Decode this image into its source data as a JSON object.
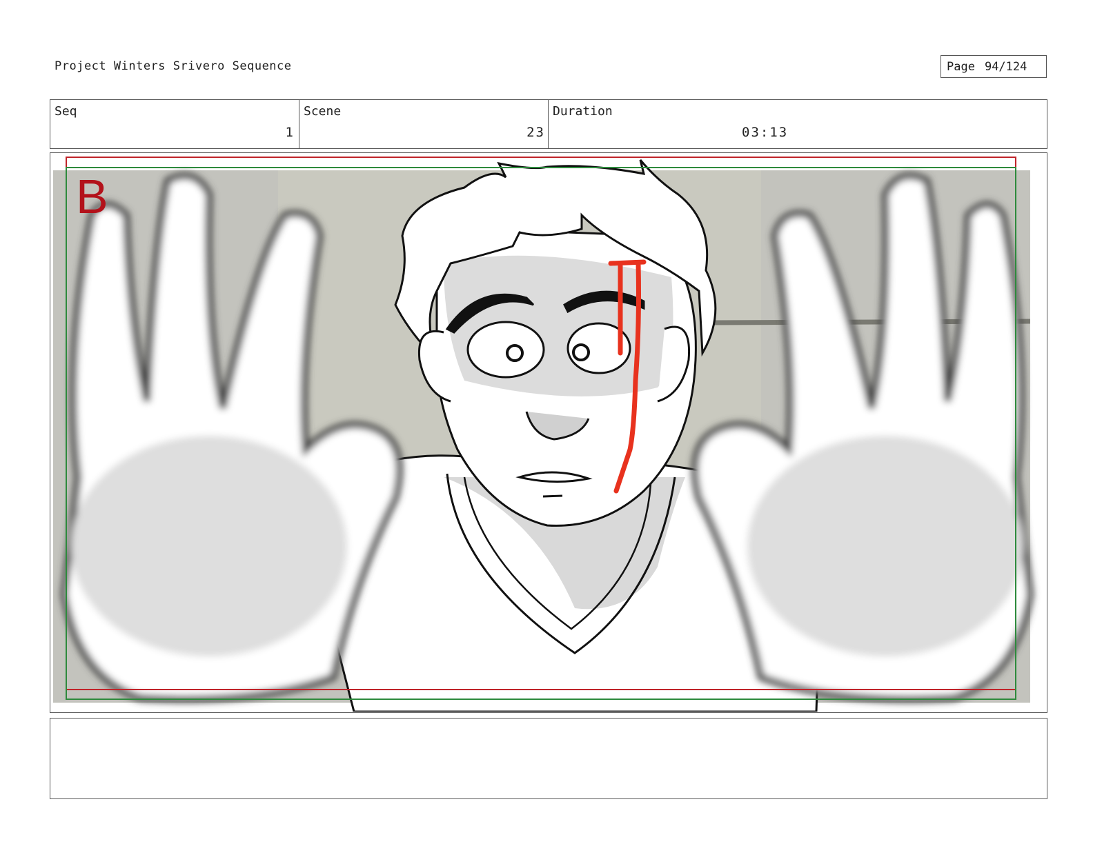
{
  "header": {
    "project_title": "Project Winters Srivero Sequence",
    "page_label": "Page",
    "page_value": "94/124"
  },
  "info": {
    "seq_label": "Seq",
    "seq_value": "1",
    "scene_label": "Scene",
    "scene_value": "23",
    "duration_label": "Duration",
    "duration_value": "03:13"
  },
  "panel": {
    "panel_letter": "B",
    "description": "",
    "colors": {
      "safe_frame_red": "#c0242a",
      "title_safe_green": "#2d8a3c",
      "blood_red": "#e8321e",
      "background_gray": "#bfbfb6"
    }
  },
  "notes": {
    "text": ""
  }
}
